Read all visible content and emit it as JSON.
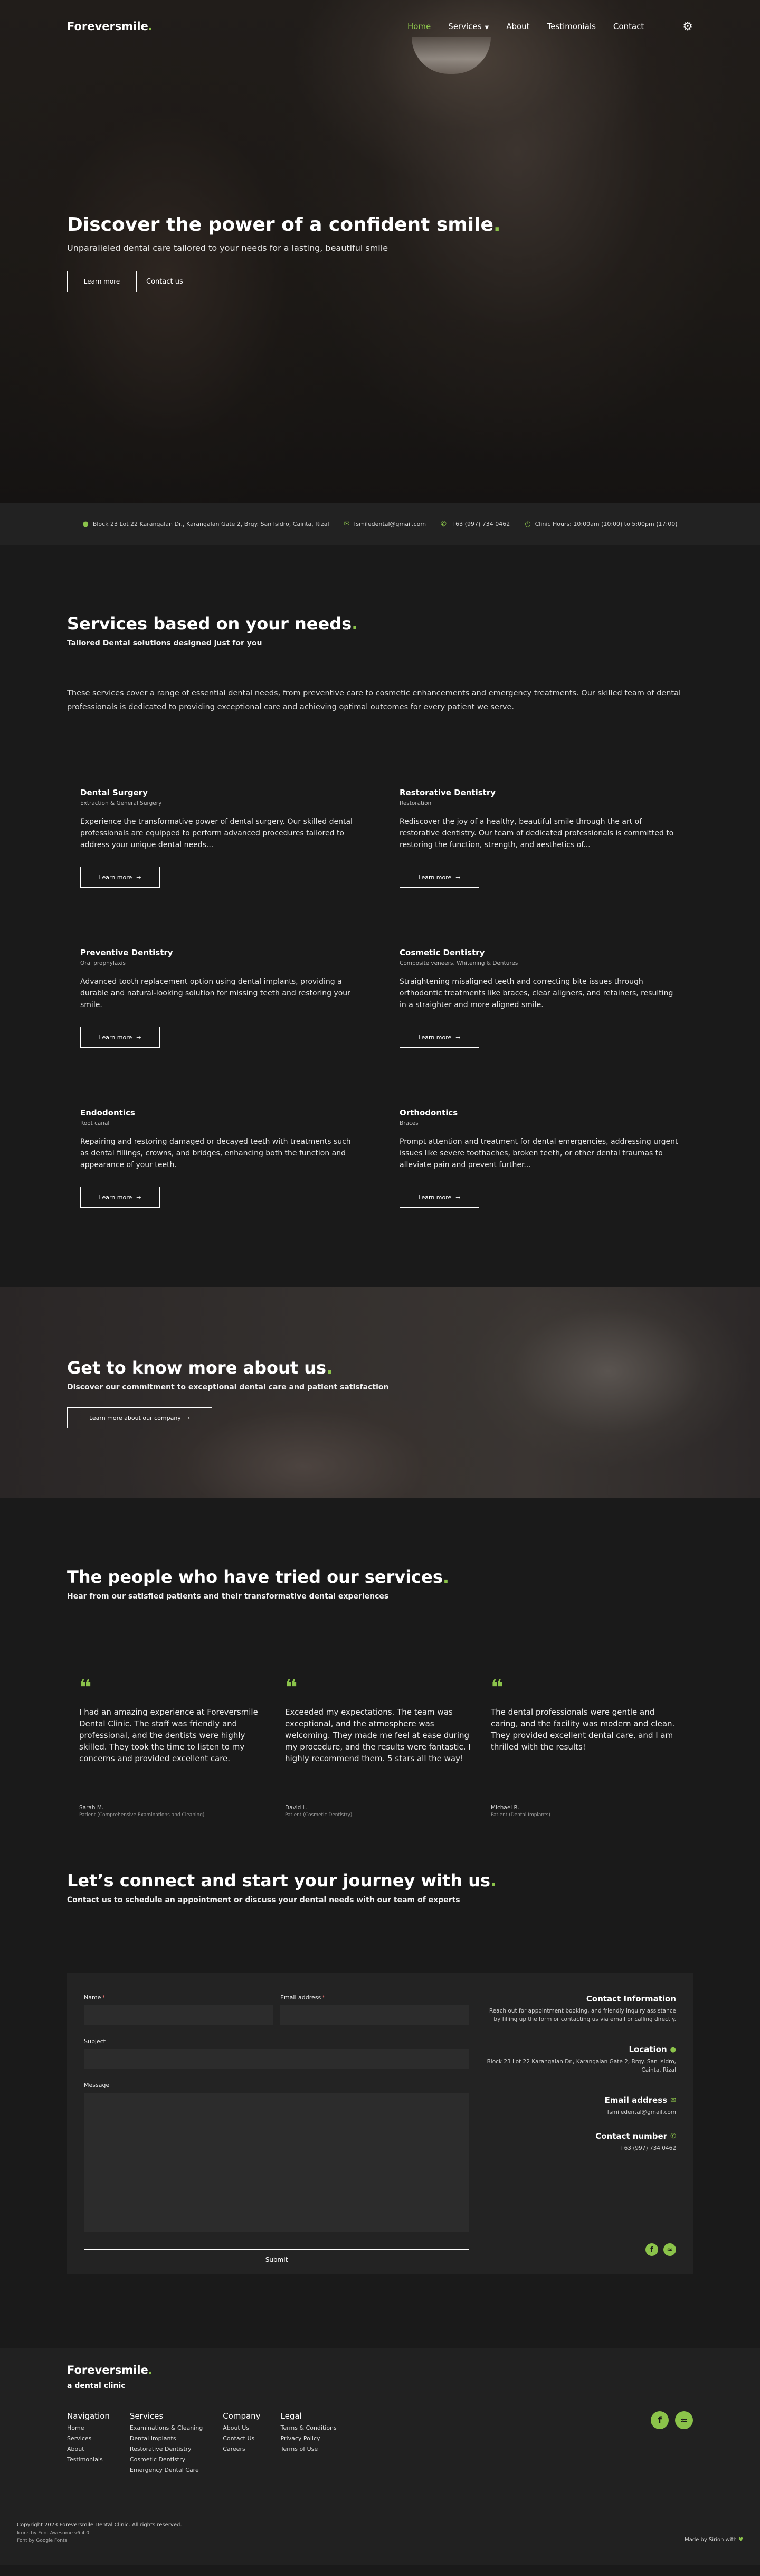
{
  "nav": {
    "logo": "Foreversmile",
    "items": [
      "Home",
      "Services",
      "About",
      "Testimonials",
      "Contact"
    ],
    "active": "Home",
    "theme_icon": "gear-icon"
  },
  "hero": {
    "title": "Discover the power of a confident smile",
    "subtitle": "Unparalleled dental care tailored to your needs for a lasting, beautiful smile",
    "primary_button": "Learn more",
    "secondary_button": "Contact us"
  },
  "info_bar": {
    "address": "Block 23 Lot 22 Karangalan Dr., Karangalan Gate 2, Brgy. San Isidro, Cainta, Rizal",
    "email": "fsmiledental@gmail.com",
    "phone": "+63 (997) 734 0462",
    "hours": "Clinic Hours: 10:00am (10:00) to 5:00pm (17:00)"
  },
  "services": {
    "title": "Services based on your needs",
    "subtitle": "Tailored Dental solutions designed just for you",
    "description": "These services cover a range of essential dental needs, from preventive care to cosmetic enhancements and emergency treatments. Our skilled team of dental professionals is dedicated to providing exceptional care and achieving optimal outcomes for every patient we serve.",
    "button_label": "Learn more",
    "items": [
      {
        "title": "Dental Surgery",
        "category": "Extraction & General Surgery",
        "text": "Experience the transformative power of dental surgery. Our skilled dental professionals are equipped to perform advanced procedures tailored to address your unique dental needs..."
      },
      {
        "title": "Restorative Dentistry",
        "category": "Restoration",
        "text": "Rediscover the joy of a healthy, beautiful smile through the art of restorative dentistry. Our team of dedicated professionals is committed to restoring the function, strength, and aesthetics of..."
      },
      {
        "title": "Preventive Dentistry",
        "category": "Oral prophylaxis",
        "text": "Advanced tooth replacement option using dental implants, providing a durable and natural-looking solution for missing teeth and restoring your smile."
      },
      {
        "title": "Cosmetic Dentistry",
        "category": "Composite veneers, Whitening & Dentures",
        "text": "Straightening misaligned teeth and correcting bite issues through orthodontic treatments like braces, clear aligners, and retainers, resulting in a straighter and more aligned smile."
      },
      {
        "title": "Endodontics",
        "category": "Root canal",
        "text": "Repairing and restoring damaged or decayed teeth with treatments such as dental fillings, crowns, and bridges, enhancing both the function and appearance of your teeth."
      },
      {
        "title": "Orthodontics",
        "category": "Braces",
        "text": "Prompt attention and treatment for dental emergencies, addressing urgent issues like severe toothaches, broken teeth, or other dental traumas to alleviate pain and prevent further..."
      }
    ]
  },
  "about": {
    "title": "Get to know more about us",
    "subtitle": "Discover our commitment to exceptional dental care and patient satisfaction",
    "button": "Learn more about our company"
  },
  "testimonials": {
    "title": "The people who have tried our services",
    "subtitle": "Hear from our satisfied patients and their transformative dental experiences",
    "items": [
      {
        "text": "I had an amazing experience at Foreversmile Dental Clinic. The staff was friendly and professional, and the dentists were highly skilled. They took the time to listen to my concerns and provided excellent care.",
        "name": "Sarah M.",
        "role": "Patient (Comprehensive Examinations and Cleaning)"
      },
      {
        "text": "Exceeded my expectations. The team was exceptional, and the atmosphere was welcoming. They made me feel at ease during my procedure, and the results were fantastic. I highly recommend them. 5 stars all the way!",
        "name": "David L.",
        "role": "Patient (Cosmetic Dentistry)"
      },
      {
        "text": "The dental professionals were gentle and caring, and the facility was modern and clean. They provided excellent dental care, and I am thrilled with the results!",
        "name": "Michael R.",
        "role": "Patient (Dental Implants)"
      }
    ]
  },
  "contact": {
    "title": "Let’s connect and start your journey with us",
    "subtitle": "Contact us to schedule an appointment or discuss your dental needs with our team of experts",
    "form": {
      "name_label": "Name",
      "email_label": "Email address",
      "subject_label": "Subject",
      "message_label": "Message",
      "submit": "Submit"
    },
    "info": {
      "heading": "Contact Information",
      "intro": "Reach out for appointment booking, and friendly inquiry assistance by filling up the form or contacting us via email or calling directly.",
      "location_heading": "Location",
      "location": "Block 23 Lot 22 Karangalan Dr., Karangalan Gate 2, Brgy. San Isidro, Cainta, Rizal",
      "email_heading": "Email address",
      "email": "fsmiledental@gmail.com",
      "phone_heading": "Contact number",
      "phone": "+63 (997) 734 0462"
    }
  },
  "footer": {
    "brand": "Foreversmile",
    "tagline": "a dental clinic",
    "columns": [
      {
        "heading": "Navigation",
        "links": [
          "Home",
          "Services",
          "About",
          "Testimonials"
        ]
      },
      {
        "heading": "Services",
        "links": [
          "Examinations & Cleaning",
          "Dental Implants",
          "Restorative Dentistry",
          "Cosmetic Dentistry",
          "Emergency Dental Care"
        ]
      },
      {
        "heading": "Company",
        "links": [
          "About Us",
          "Contact Us",
          "Careers"
        ]
      },
      {
        "heading": "Legal",
        "links": [
          "Terms & Conditions",
          "Privacy Policy",
          "Terms of Use"
        ]
      }
    ],
    "copyright": "Copyright 2023 Foreversmile Dental Clinic. All rights reserved.",
    "icons_credit": "Icons by Font Awesome v6.4.0",
    "font_credit": "Font by Google Fonts",
    "made_by": "Made by Sirion",
    "made_with": "with"
  },
  "colors": {
    "accent": "#8bc34a",
    "background": "#1a1a1a",
    "panel": "#232323"
  }
}
